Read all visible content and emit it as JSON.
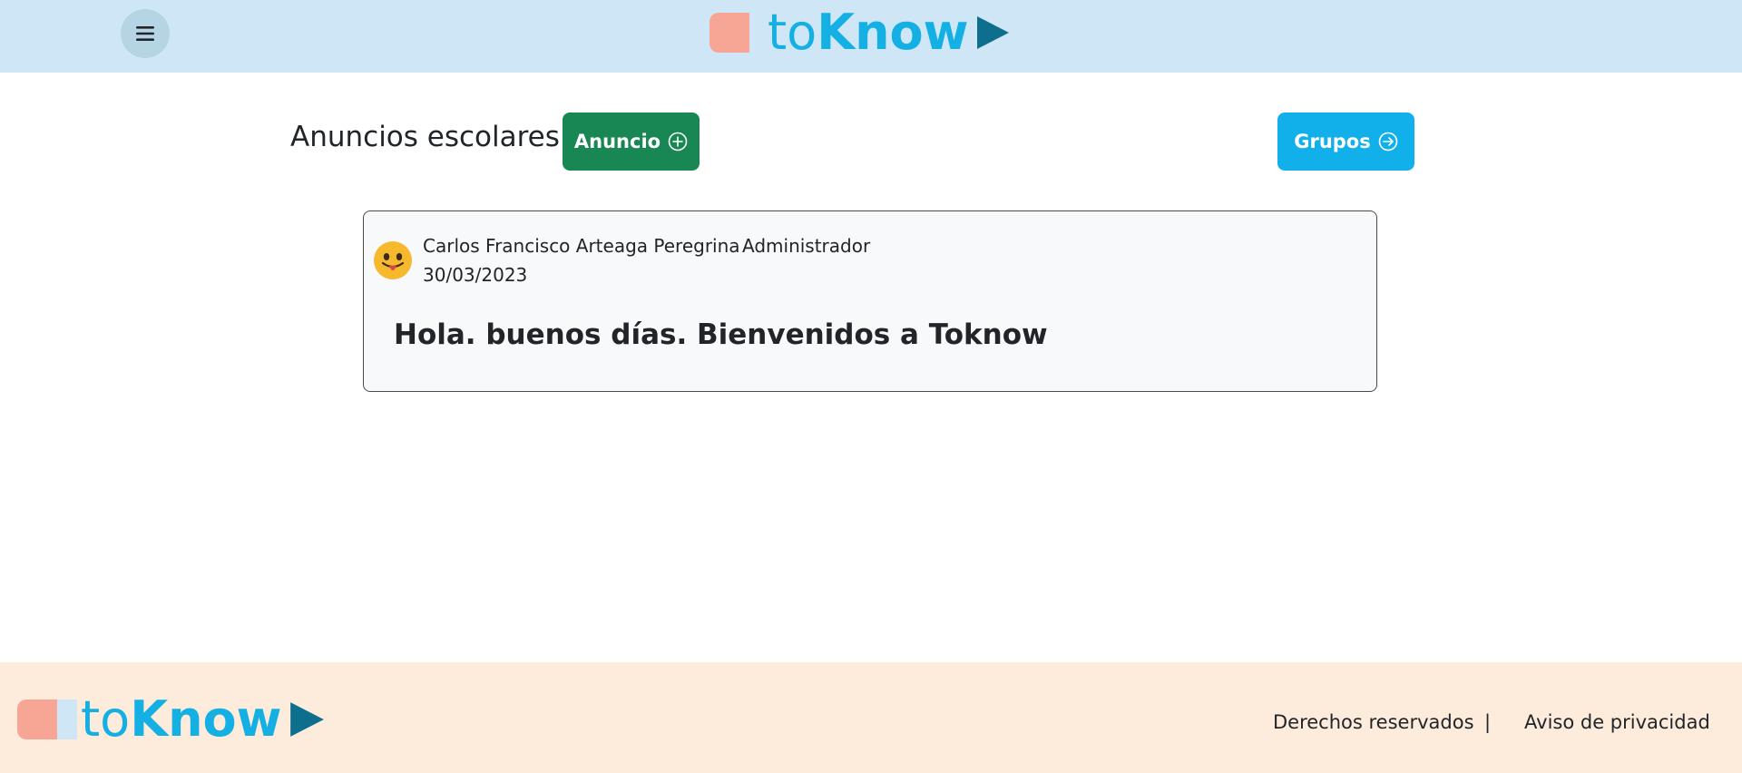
{
  "header": {
    "menu_icon": "hamburger-menu-icon",
    "brand_light": "to",
    "brand_bold": "Know"
  },
  "main": {
    "title": "Anuncios escolares",
    "new_announcement_label": "Anuncio",
    "new_announcement_icon": "plus-circle-icon",
    "groups_label": "Grupos",
    "groups_icon": "arrow-right-circle-icon"
  },
  "announcements": [
    {
      "author": "Carlos Francisco Arteaga Peregrina",
      "role": "Administrador",
      "date": "30/03/2023",
      "avatar_icon": "tongue-out-emoji-icon",
      "message": "Hola. buenos días. Bienvenidos a Toknow"
    }
  ],
  "footer": {
    "brand_light": "to",
    "brand_bold": "Know",
    "rights_label": "Derechos reservados",
    "separator": "|",
    "privacy_label": "Aviso de privacidad"
  },
  "colors": {
    "header_bg": "#cfe6f6",
    "footer_bg": "#fdebdc",
    "brand_blue": "#14b0e4",
    "brand_dark": "#0e6e8e",
    "brand_pink": "#f7a696",
    "success_green": "#198754",
    "info_blue": "#12b0ea"
  }
}
